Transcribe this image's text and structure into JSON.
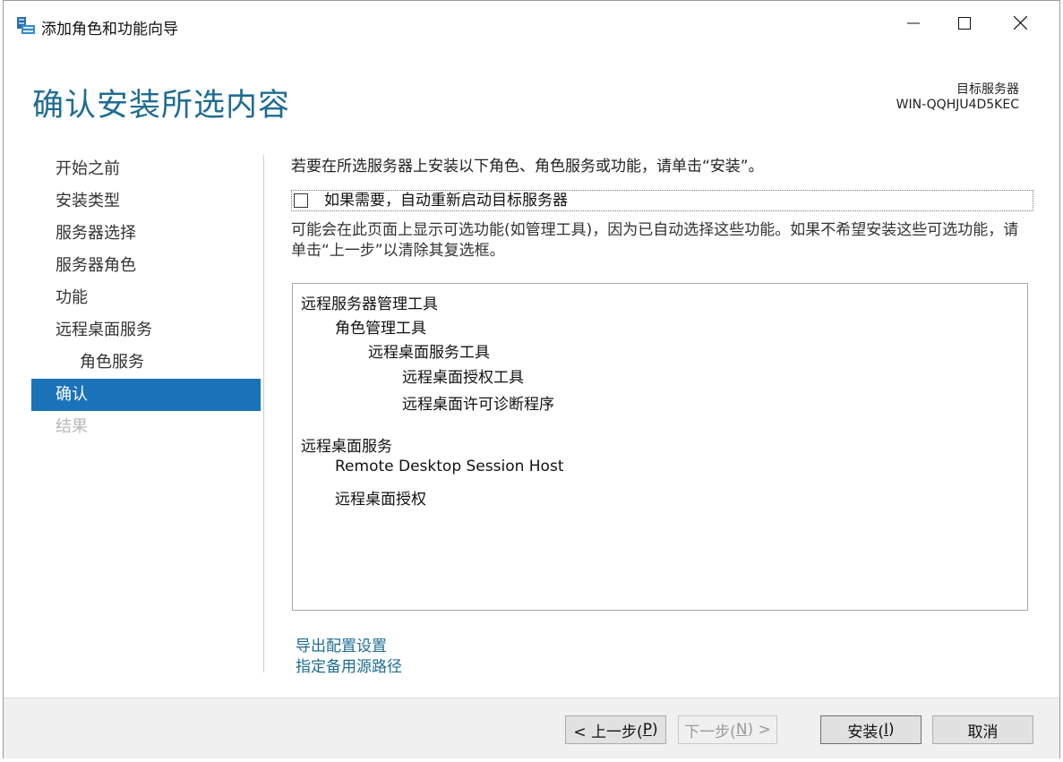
{
  "window": {
    "title": "添加角色和功能向导",
    "icons": [
      "server-manager-icon",
      "minimize-icon",
      "maximize-icon",
      "close-icon"
    ]
  },
  "header": {
    "page_title": "确认安装所选内容",
    "destination_label": "目标服务器",
    "destination_value": "WIN-QQHJU4D5KEC"
  },
  "nav": {
    "items": [
      {
        "label": "开始之前",
        "state": "normal"
      },
      {
        "label": "安装类型",
        "state": "normal"
      },
      {
        "label": "服务器选择",
        "state": "normal"
      },
      {
        "label": "服务器角色",
        "state": "normal"
      },
      {
        "label": "功能",
        "state": "normal"
      },
      {
        "label": "远程桌面服务",
        "state": "normal"
      },
      {
        "label": "角色服务",
        "state": "sub"
      },
      {
        "label": "确认",
        "state": "active"
      },
      {
        "label": "结果",
        "state": "disabled"
      }
    ]
  },
  "content": {
    "intro": "若要在所选服务器上安装以下角色、角色服务或功能，请单击“安装”。",
    "restart_checkbox_label": "如果需要，自动重新启动目标服务器",
    "restart_checked": false,
    "note": "可能会在此页面上显示可选功能(如管理工具)，因为已自动选择这些功能。如果不希望安装这些可选功能，请单击“上一步”以清除其复选框。",
    "selections": [
      "远程服务器管理工具",
      "角色管理工具",
      "远程桌面服务工具",
      "远程桌面授权工具",
      "远程桌面许可诊断程序",
      "远程桌面服务",
      "Remote Desktop Session Host",
      "远程桌面授权"
    ],
    "links": [
      "导出配置设置",
      "指定备用源路径"
    ]
  },
  "footer": {
    "prev": {
      "text": "< 上一步(",
      "key": "P",
      "suffix": ")"
    },
    "next": {
      "text": "下一步(",
      "key": "N",
      "suffix": ") >"
    },
    "install": {
      "text": "安装(",
      "key": "I",
      "suffix": ")"
    },
    "cancel": "取消"
  },
  "colors": {
    "accent": "#1a73b8",
    "title": "#1f6c93",
    "disabled": "#b9b9b9"
  }
}
